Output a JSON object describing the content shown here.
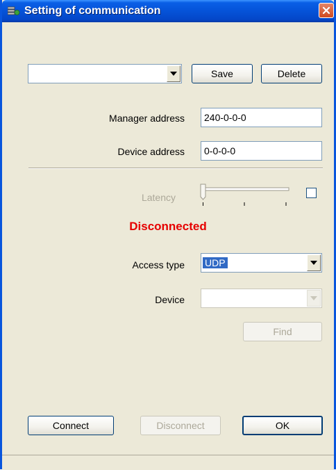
{
  "window": {
    "title": "Setting of communication"
  },
  "profile": {
    "selected": "",
    "save_label": "Save",
    "delete_label": "Delete"
  },
  "manager_address": {
    "label": "Manager address",
    "value": "240-0-0-0"
  },
  "device_address": {
    "label": "Device address",
    "value": "0-0-0-0"
  },
  "latency": {
    "label": "Latency",
    "level": 0,
    "checked": false
  },
  "status": {
    "text": "Disconnected",
    "color": "#e60000"
  },
  "access_type": {
    "label": "Access type",
    "value": "UDP"
  },
  "device": {
    "label": "Device",
    "value": ""
  },
  "find_label": "Find",
  "footer": {
    "connect_label": "Connect",
    "disconnect_label": "Disconnect",
    "ok_label": "OK"
  },
  "colors": {
    "accent": "#0855dd",
    "selection": "#316ac5",
    "dialog_bg": "#ece9d8"
  },
  "icons": [
    "app-icon",
    "close-icon",
    "dropdown-arrow-icon"
  ]
}
